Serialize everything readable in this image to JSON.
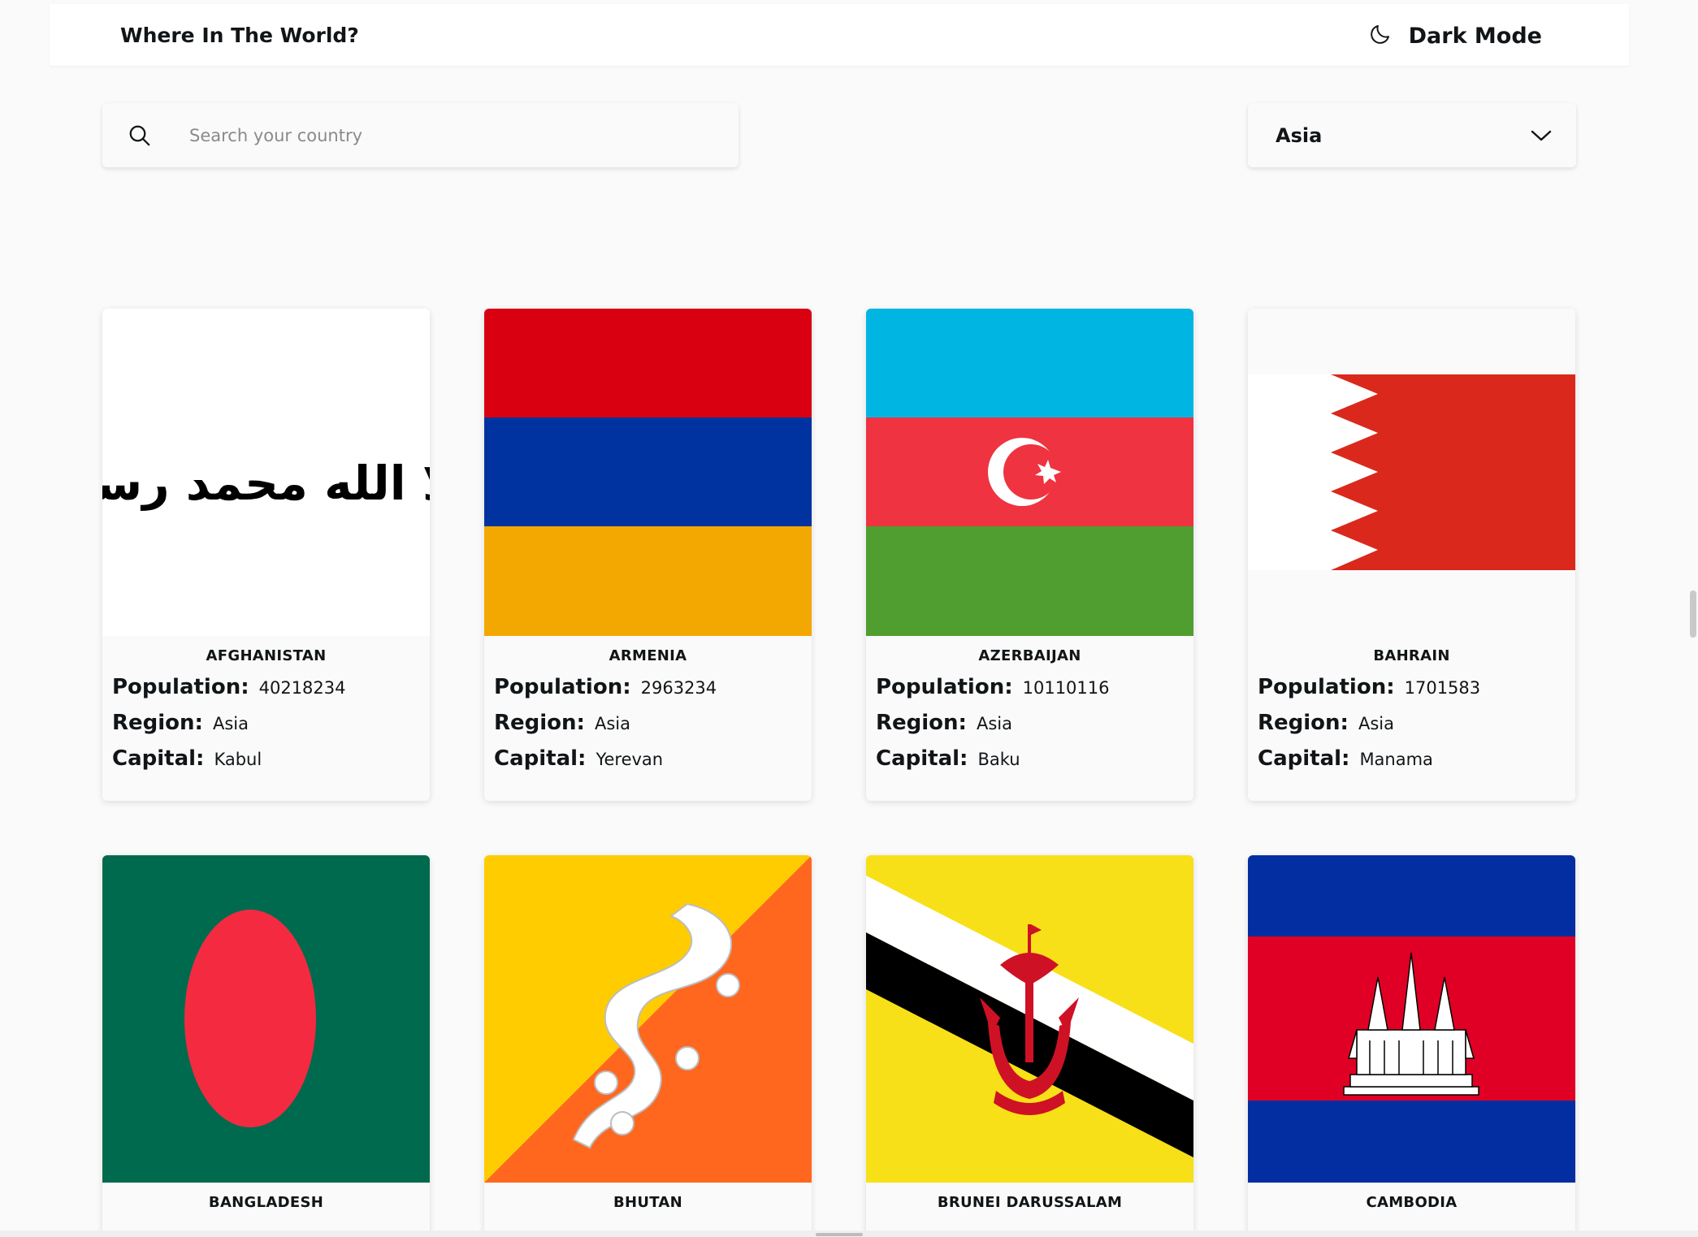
{
  "header": {
    "title": "Where In The World?",
    "dark_mode_label": "Dark Mode",
    "dark_mode_icon": "moon-icon"
  },
  "search": {
    "placeholder": "Search your country",
    "value": "",
    "icon": "search-icon"
  },
  "filter": {
    "selected": "Asia",
    "icon": "chevron-down-icon"
  },
  "labels": {
    "population": "Population:",
    "region": "Region:",
    "capital": "Capital:"
  },
  "countries": [
    {
      "name": "AFGHANISTAN",
      "population": "40218234",
      "region": "Asia",
      "capital": "Kabul",
      "flag_text": "لا إله إلا الله محمد رسول الله"
    },
    {
      "name": "ARMENIA",
      "population": "2963234",
      "region": "Asia",
      "capital": "Yerevan"
    },
    {
      "name": "AZERBAIJAN",
      "population": "10110116",
      "region": "Asia",
      "capital": "Baku"
    },
    {
      "name": "BAHRAIN",
      "population": "1701583",
      "region": "Asia",
      "capital": "Manama"
    },
    {
      "name": "BANGLADESH"
    },
    {
      "name": "BHUTAN"
    },
    {
      "name": "BRUNEI DARUSSALAM"
    },
    {
      "name": "CAMBODIA"
    }
  ],
  "colors": {
    "background": "#fafafa",
    "text": "#111517",
    "armenia": [
      "#d90012",
      "#0033a0",
      "#f2a800"
    ],
    "azerbaijan": [
      "#00b5e2",
      "#ef3340",
      "#509e2f"
    ],
    "bahrain": "#da291c",
    "bangladesh": [
      "#006a4e",
      "#f42a41"
    ],
    "bhutan": [
      "#ffcc00",
      "#ff671f"
    ],
    "brunei": [
      "#f7e017",
      "#ffffff",
      "#000000",
      "#cf1126"
    ],
    "cambodia": [
      "#032ea1",
      "#e00025"
    ]
  }
}
